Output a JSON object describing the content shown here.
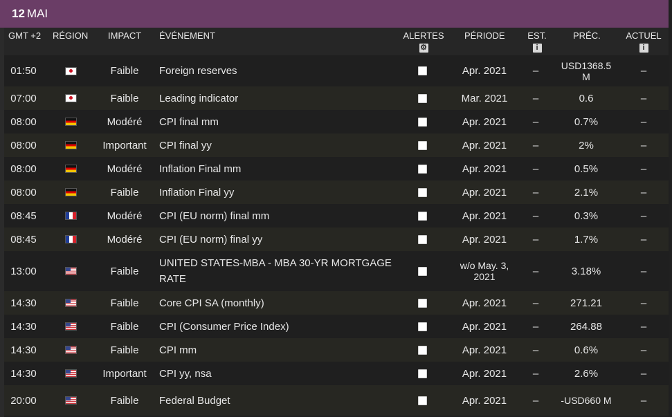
{
  "date": {
    "day": "12",
    "month": "MAI"
  },
  "headers": {
    "time": "GMT +2",
    "region": "RÉGION",
    "impact": "IMPACT",
    "event": "ÉVÉNEMENT",
    "alerts": "ALERTES",
    "period": "PÉRIODE",
    "est": "EST.",
    "prev": "PRÉC.",
    "actual": "ACTUEL"
  },
  "rows": [
    {
      "time": "01:50",
      "region": "jp",
      "impact": "Faible",
      "event": "Foreign reserves",
      "period": "Apr. 2021",
      "est": "–",
      "prev": "USD1368.5 M",
      "actual": "–"
    },
    {
      "time": "07:00",
      "region": "jp",
      "impact": "Faible",
      "event": "Leading indicator",
      "period": "Mar. 2021",
      "est": "–",
      "prev": "0.6",
      "actual": "–"
    },
    {
      "time": "08:00",
      "region": "de",
      "impact": "Modéré",
      "event": "CPI final mm",
      "period": "Apr. 2021",
      "est": "–",
      "prev": "0.7%",
      "actual": "–"
    },
    {
      "time": "08:00",
      "region": "de",
      "impact": "Important",
      "event": "CPI final yy",
      "period": "Apr. 2021",
      "est": "–",
      "prev": "2%",
      "actual": "–"
    },
    {
      "time": "08:00",
      "region": "de",
      "impact": "Modéré",
      "event": "Inflation Final mm",
      "period": "Apr. 2021",
      "est": "–",
      "prev": "0.5%",
      "actual": "–"
    },
    {
      "time": "08:00",
      "region": "de",
      "impact": "Faible",
      "event": "Inflation Final yy",
      "period": "Apr. 2021",
      "est": "–",
      "prev": "2.1%",
      "actual": "–"
    },
    {
      "time": "08:45",
      "region": "fr",
      "impact": "Modéré",
      "event": "CPI (EU norm) final mm",
      "period": "Apr. 2021",
      "est": "–",
      "prev": "0.3%",
      "actual": "–"
    },
    {
      "time": "08:45",
      "region": "fr",
      "impact": "Modéré",
      "event": "CPI (EU norm) final yy",
      "period": "Apr. 2021",
      "est": "–",
      "prev": "1.7%",
      "actual": "–"
    },
    {
      "time": "13:00",
      "region": "us",
      "impact": "Faible",
      "event": "UNITED STATES-MBA - MBA 30-YR MORTGAGE RATE",
      "period": "w/o May. 3, 2021",
      "est": "–",
      "prev": "3.18%",
      "actual": "–"
    },
    {
      "time": "14:30",
      "region": "us",
      "impact": "Faible",
      "event": "Core CPI SA (monthly)",
      "period": "Apr. 2021",
      "est": "–",
      "prev": "271.21",
      "actual": "–"
    },
    {
      "time": "14:30",
      "region": "us",
      "impact": "Faible",
      "event": "CPI (Consumer Price Index)",
      "period": "Apr. 2021",
      "est": "–",
      "prev": "264.88",
      "actual": "–"
    },
    {
      "time": "14:30",
      "region": "us",
      "impact": "Faible",
      "event": "CPI mm",
      "period": "Apr. 2021",
      "est": "–",
      "prev": "0.6%",
      "actual": "–"
    },
    {
      "time": "14:30",
      "region": "us",
      "impact": "Important",
      "event": "CPI yy, nsa",
      "period": "Apr. 2021",
      "est": "–",
      "prev": "2.6%",
      "actual": "–"
    },
    {
      "time": "20:00",
      "region": "us",
      "impact": "Faible",
      "event": "Federal Budget",
      "period": "Apr. 2021",
      "est": "–",
      "prev": "-USD660 M",
      "actual": "–"
    }
  ],
  "colors": {
    "date_bar": "#6a3d66",
    "row_dark": "#1f1f1f",
    "row_alt": "#272722",
    "header_bg": "#262626"
  }
}
